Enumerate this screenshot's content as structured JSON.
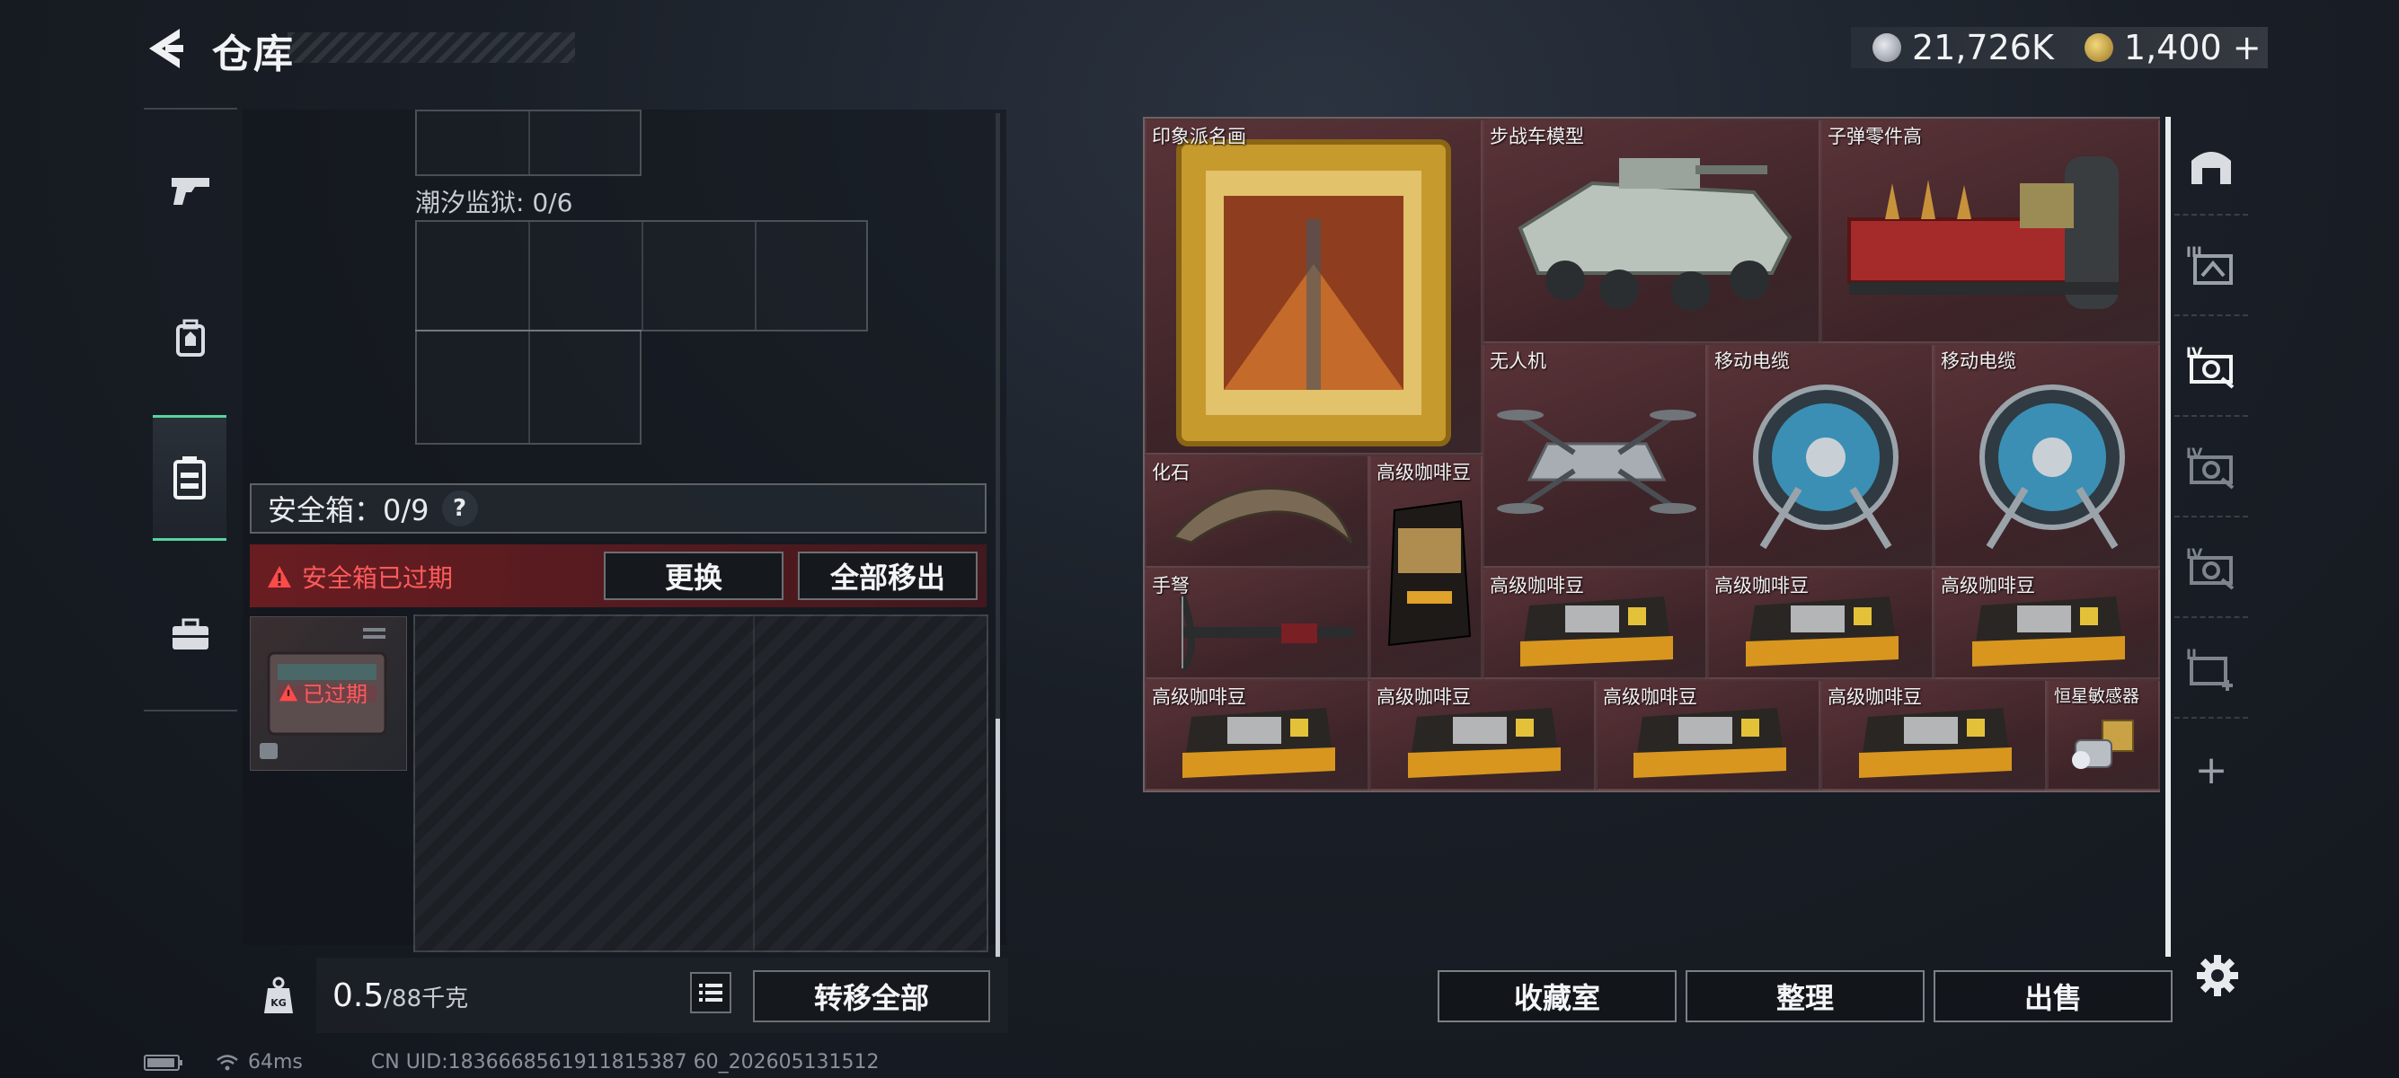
{
  "header": {
    "title": "仓库",
    "currency_silver": "21,726K",
    "currency_gold": "1,400",
    "gold_plus": "+"
  },
  "left_panel": {
    "prison_label": "潮汐监狱: 0/6",
    "safe_box_label": "安全箱：0/9",
    "help": "?",
    "expired_warning": "安全箱已过期",
    "replace_button": "更换",
    "move_all_out_button": "全部移出",
    "expired_badge": "已过期",
    "weight_value": "0.5",
    "weight_capacity": "/88千克",
    "weight_icon_text": "KG",
    "transfer_all_button": "转移全部"
  },
  "items": [
    {
      "name": "印象派名画"
    },
    {
      "name": "步战车模型"
    },
    {
      "name": "子弹零件高"
    },
    {
      "name": "无人机"
    },
    {
      "name": "移动电缆"
    },
    {
      "name": "移动电缆"
    },
    {
      "name": "化石"
    },
    {
      "name": "高级咖啡豆"
    },
    {
      "name": "手弩"
    },
    {
      "name": "高级咖啡豆"
    },
    {
      "name": "高级咖啡豆"
    },
    {
      "name": "高级咖啡豆"
    },
    {
      "name": "高级咖啡豆"
    },
    {
      "name": "高级咖啡豆"
    },
    {
      "name": "高级咖啡豆"
    },
    {
      "name": "高级咖啡豆"
    },
    {
      "name": "恒星敏感器"
    }
  ],
  "right_tabs": {
    "tab_iii": "III",
    "tab_iv_a": "IV",
    "tab_iv_b": "IV",
    "tab_iv_c": "IV",
    "tab_ii": "II",
    "add": "+"
  },
  "bottom_buttons": {
    "collection": "收藏室",
    "organize": "整理",
    "sell": "出售"
  },
  "status": {
    "ping": "64ms",
    "uid": "CN UID:1836668561911815387 60_202605131512"
  },
  "colors": {
    "accent_green": "#57d3a0",
    "warning_red": "#ff5a5a",
    "item_bg": "#4a2a2f"
  }
}
